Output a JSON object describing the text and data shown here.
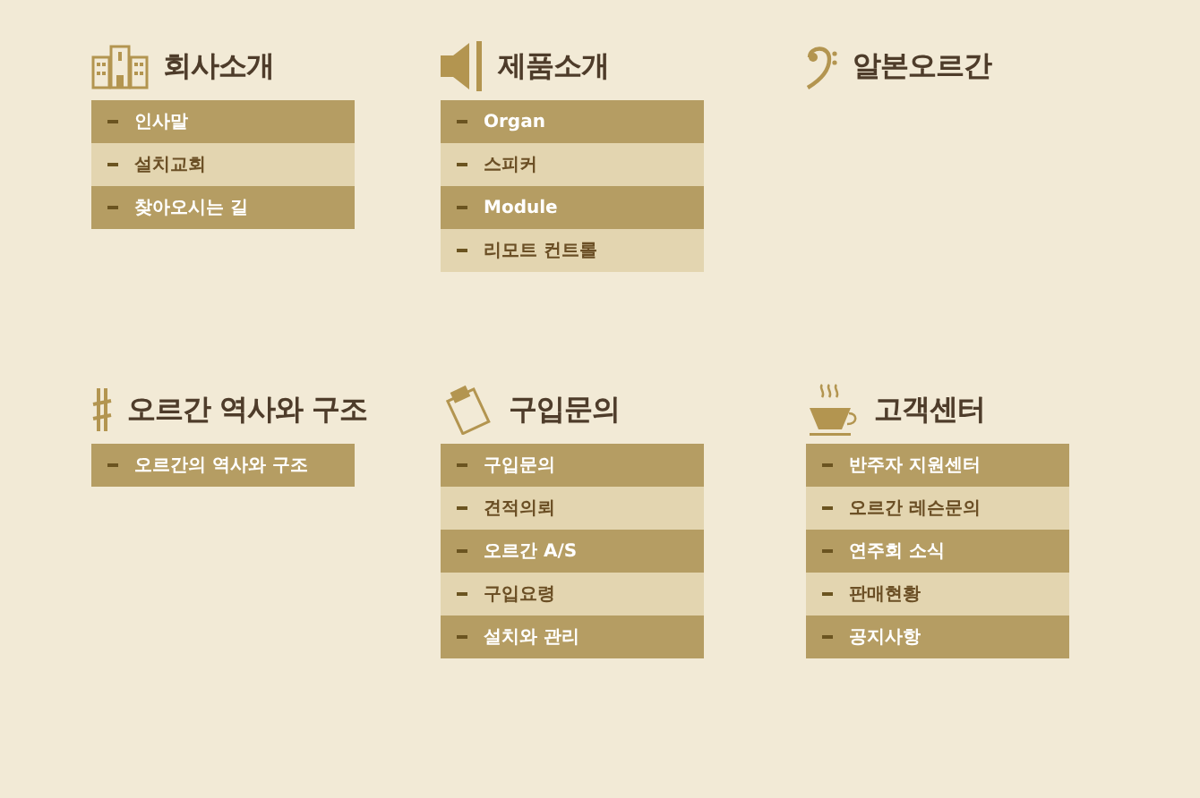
{
  "sections": [
    {
      "title": "회사소개",
      "items": [
        "인사말",
        "설치교회",
        "찾아오시는 길"
      ]
    },
    {
      "title": "제품소개",
      "items": [
        "Organ",
        "스피커",
        "Module",
        "리모트 컨트롤"
      ]
    },
    {
      "title": "알본오르간"
    },
    {
      "title": "오르간 역사와 구조",
      "items": [
        "오르간의 역사와 구조"
      ]
    },
    {
      "title": "구입문의",
      "items": [
        "구입문의",
        "견적의뢰",
        "오르간 A/S",
        "구입요령",
        "설치와 관리"
      ]
    },
    {
      "title": "고객센터",
      "items": [
        "반주자 지원센터",
        "오르간 레슨문의",
        "연주회 소식",
        "판매현황",
        "공지사항"
      ]
    }
  ]
}
